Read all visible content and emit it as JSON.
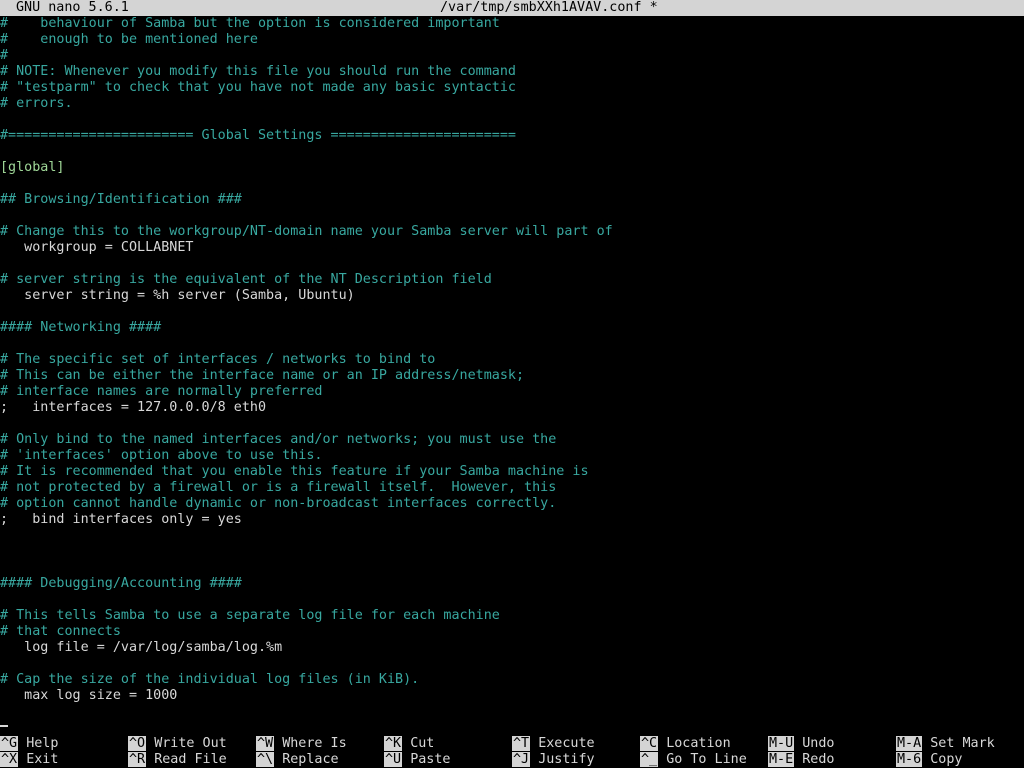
{
  "titlebar": {
    "app": "GNU nano 5.6.1",
    "file": "/var/tmp/smbXXh1AVAV.conf *"
  },
  "editor": {
    "lines": [
      {
        "text": "#    behaviour of Samba but the option is considered important",
        "kind": "comment"
      },
      {
        "text": "#    enough to be mentioned here",
        "kind": "comment"
      },
      {
        "text": "#",
        "kind": "comment"
      },
      {
        "text": "# NOTE: Whenever you modify this file you should run the command",
        "kind": "comment"
      },
      {
        "text": "# \"testparm\" to check that you have not made any basic syntactic",
        "kind": "comment"
      },
      {
        "text": "# errors.",
        "kind": "comment"
      },
      {
        "text": "",
        "kind": "text"
      },
      {
        "text": "#======================= Global Settings =======================",
        "kind": "comment"
      },
      {
        "text": "",
        "kind": "text"
      },
      {
        "text": "[global]",
        "kind": "section"
      },
      {
        "text": "",
        "kind": "text"
      },
      {
        "text": "## Browsing/Identification ###",
        "kind": "comment"
      },
      {
        "text": "",
        "kind": "text"
      },
      {
        "text": "# Change this to the workgroup/NT-domain name your Samba server will part of",
        "kind": "comment"
      },
      {
        "text": "   workgroup = COLLABNET",
        "kind": "text"
      },
      {
        "text": "",
        "kind": "text"
      },
      {
        "text": "# server string is the equivalent of the NT Description field",
        "kind": "comment"
      },
      {
        "text": "   server string = %h server (Samba, Ubuntu)",
        "kind": "text"
      },
      {
        "text": "",
        "kind": "text"
      },
      {
        "text": "#### Networking ####",
        "kind": "comment"
      },
      {
        "text": "",
        "kind": "text"
      },
      {
        "text": "# The specific set of interfaces / networks to bind to",
        "kind": "comment"
      },
      {
        "text": "# This can be either the interface name or an IP address/netmask;",
        "kind": "comment"
      },
      {
        "text": "# interface names are normally preferred",
        "kind": "comment"
      },
      {
        "text": ";   interfaces = 127.0.0.0/8 eth0",
        "kind": "text"
      },
      {
        "text": "",
        "kind": "text"
      },
      {
        "text": "# Only bind to the named interfaces and/or networks; you must use the",
        "kind": "comment"
      },
      {
        "text": "# 'interfaces' option above to use this.",
        "kind": "comment"
      },
      {
        "text": "# It is recommended that you enable this feature if your Samba machine is",
        "kind": "comment"
      },
      {
        "text": "# not protected by a firewall or is a firewall itself.  However, this",
        "kind": "comment"
      },
      {
        "text": "# option cannot handle dynamic or non-broadcast interfaces correctly.",
        "kind": "comment"
      },
      {
        "text": ";   bind interfaces only = yes",
        "kind": "text"
      },
      {
        "text": "",
        "kind": "text"
      },
      {
        "text": "",
        "kind": "text"
      },
      {
        "text": "",
        "kind": "text"
      },
      {
        "text": "#### Debugging/Accounting ####",
        "kind": "comment"
      },
      {
        "text": "",
        "kind": "text"
      },
      {
        "text": "# This tells Samba to use a separate log file for each machine",
        "kind": "comment"
      },
      {
        "text": "# that connects",
        "kind": "comment"
      },
      {
        "text": "   log file = /var/log/samba/log.%m",
        "kind": "text"
      },
      {
        "text": "",
        "kind": "text"
      },
      {
        "text": "# Cap the size of the individual log files (in KiB).",
        "kind": "comment"
      },
      {
        "text": "   max log size = 1000",
        "kind": "text"
      }
    ]
  },
  "shortcuts": [
    {
      "key": "^G",
      "label": "Help"
    },
    {
      "key": "^X",
      "label": "Exit"
    },
    {
      "key": "^O",
      "label": "Write Out"
    },
    {
      "key": "^R",
      "label": "Read File"
    },
    {
      "key": "^W",
      "label": "Where Is"
    },
    {
      "key": "^\\",
      "label": "Replace"
    },
    {
      "key": "^K",
      "label": "Cut"
    },
    {
      "key": "^U",
      "label": "Paste"
    },
    {
      "key": "^T",
      "label": "Execute"
    },
    {
      "key": "^J",
      "label": "Justify"
    },
    {
      "key": "^C",
      "label": "Location"
    },
    {
      "key": "^_",
      "label": "Go To Line"
    },
    {
      "key": "M-U",
      "label": "Undo"
    },
    {
      "key": "M-E",
      "label": "Redo"
    },
    {
      "key": "M-A",
      "label": "Set Mark"
    },
    {
      "key": "M-6",
      "label": "Copy"
    }
  ],
  "colors": {
    "comment": "#38a8a0",
    "section": "#a0d898",
    "text": "#d8d8d8",
    "bar": "#d4d4d4",
    "background": "#000000"
  }
}
